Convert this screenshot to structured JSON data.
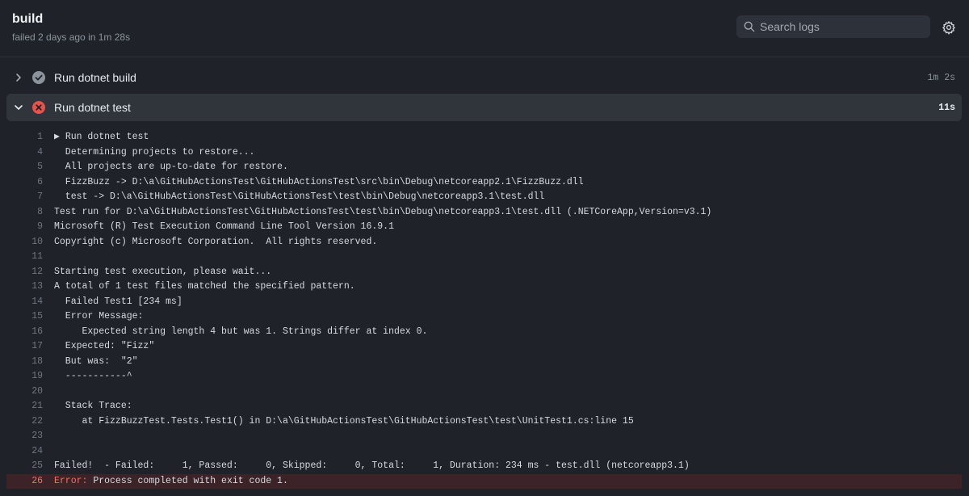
{
  "job": {
    "title": "build",
    "status_text": "failed 2 days ago in 1m 28s"
  },
  "search": {
    "placeholder": "Search logs"
  },
  "steps": [
    {
      "name": "Run dotnet build",
      "duration": "1m 2s",
      "status": "success",
      "expanded": false
    },
    {
      "name": "Run dotnet test",
      "duration": "11s",
      "status": "failed",
      "expanded": true
    }
  ],
  "log": {
    "lines": [
      {
        "num": "1",
        "text": "▶ Run dotnet test"
      },
      {
        "num": "4",
        "text": "  Determining projects to restore..."
      },
      {
        "num": "5",
        "text": "  All projects are up-to-date for restore."
      },
      {
        "num": "6",
        "text": "  FizzBuzz -> D:\\a\\GitHubActionsTest\\GitHubActionsTest\\src\\bin\\Debug\\netcoreapp2.1\\FizzBuzz.dll"
      },
      {
        "num": "7",
        "text": "  test -> D:\\a\\GitHubActionsTest\\GitHubActionsTest\\test\\bin\\Debug\\netcoreapp3.1\\test.dll"
      },
      {
        "num": "8",
        "text": "Test run for D:\\a\\GitHubActionsTest\\GitHubActionsTest\\test\\bin\\Debug\\netcoreapp3.1\\test.dll (.NETCoreApp,Version=v3.1)"
      },
      {
        "num": "9",
        "text": "Microsoft (R) Test Execution Command Line Tool Version 16.9.1"
      },
      {
        "num": "10",
        "text": "Copyright (c) Microsoft Corporation.  All rights reserved."
      },
      {
        "num": "11",
        "text": ""
      },
      {
        "num": "12",
        "text": "Starting test execution, please wait..."
      },
      {
        "num": "13",
        "text": "A total of 1 test files matched the specified pattern."
      },
      {
        "num": "14",
        "text": "  Failed Test1 [234 ms]"
      },
      {
        "num": "15",
        "text": "  Error Message:"
      },
      {
        "num": "16",
        "text": "     Expected string length 4 but was 1. Strings differ at index 0."
      },
      {
        "num": "17",
        "text": "  Expected: \"Fizz\""
      },
      {
        "num": "18",
        "text": "  But was:  \"2\""
      },
      {
        "num": "19",
        "text": "  -----------^"
      },
      {
        "num": "20",
        "text": ""
      },
      {
        "num": "21",
        "text": "  Stack Trace:"
      },
      {
        "num": "22",
        "text": "     at FizzBuzzTest.Tests.Test1() in D:\\a\\GitHubActionsTest\\GitHubActionsTest\\test\\UnitTest1.cs:line 15"
      },
      {
        "num": "23",
        "text": ""
      },
      {
        "num": "24",
        "text": ""
      },
      {
        "num": "25",
        "text": "Failed!  - Failed:     1, Passed:     0, Skipped:     0, Total:     1, Duration: 234 ms - test.dll (netcoreapp3.1)"
      }
    ],
    "error_line": {
      "num": "26",
      "prefix": "Error:",
      "text": " Process completed with exit code 1."
    }
  },
  "colors": {
    "background": "#1f2228",
    "success": "#8b949e",
    "failure": "#e5534b",
    "error_row": "#3b2327"
  }
}
